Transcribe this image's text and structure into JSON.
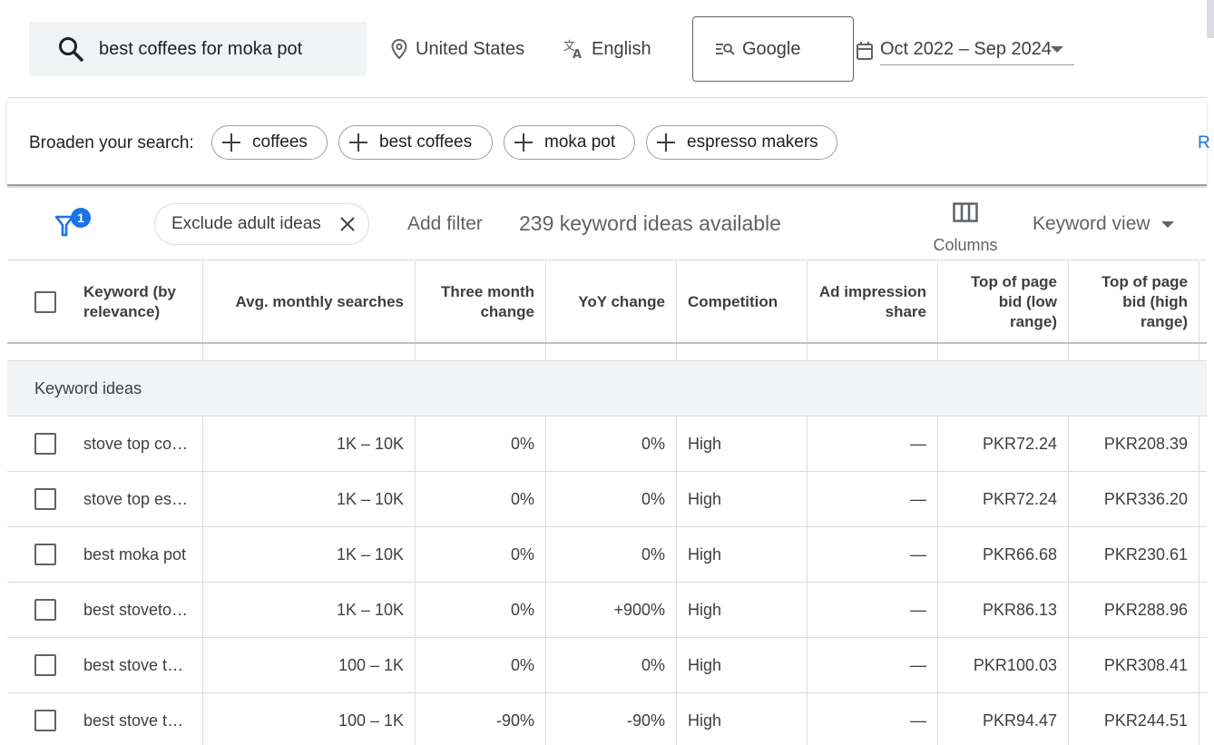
{
  "search": {
    "query": "best coffees for moka pot",
    "location": "United States",
    "language": "English",
    "network": "Google",
    "date_range": "Oct 2022 – Sep 2024"
  },
  "broaden": {
    "label": "Broaden your search:",
    "chips": [
      "coffees",
      "best coffees",
      "moka pot",
      "espresso makers"
    ],
    "more_link": "R"
  },
  "filters": {
    "badge_count": "1",
    "exclude_chip": "Exclude adult ideas",
    "add_filter": "Add filter",
    "ideas_count": "239 keyword ideas available",
    "columns_label": "Columns",
    "view_label": "Keyword view"
  },
  "table": {
    "headers": {
      "keyword": "Keyword (by relevance)",
      "searches": "Avg. monthly searches",
      "three_month": "Three month change",
      "yoy": "YoY change",
      "competition": "Competition",
      "impression": "Ad impression share",
      "bid_low": "Top of page bid (low range)",
      "bid_high": "Top of page bid (high range)"
    },
    "group_label": "Keyword ideas",
    "rows": [
      {
        "keyword": "stove top cof…",
        "searches": "1K – 10K",
        "three_month": "0%",
        "yoy": "0%",
        "competition": "High",
        "impression": "—",
        "bid_low": "PKR72.24",
        "bid_high": "PKR208.39"
      },
      {
        "keyword": "stove top es…",
        "searches": "1K – 10K",
        "three_month": "0%",
        "yoy": "0%",
        "competition": "High",
        "impression": "—",
        "bid_low": "PKR72.24",
        "bid_high": "PKR336.20"
      },
      {
        "keyword": "best moka pot",
        "searches": "1K – 10K",
        "three_month": "0%",
        "yoy": "0%",
        "competition": "High",
        "impression": "—",
        "bid_low": "PKR66.68",
        "bid_high": "PKR230.61"
      },
      {
        "keyword": "best stoveto…",
        "searches": "1K – 10K",
        "three_month": "0%",
        "yoy": "+900%",
        "competition": "High",
        "impression": "—",
        "bid_low": "PKR86.13",
        "bid_high": "PKR288.96"
      },
      {
        "keyword": "best stove to…",
        "searches": "100 – 1K",
        "three_month": "0%",
        "yoy": "0%",
        "competition": "High",
        "impression": "—",
        "bid_low": "PKR100.03",
        "bid_high": "PKR308.41"
      },
      {
        "keyword": "best stove to…",
        "searches": "100 – 1K",
        "three_month": "-90%",
        "yoy": "-90%",
        "competition": "High",
        "impression": "—",
        "bid_low": "PKR94.47",
        "bid_high": "PKR244.51"
      }
    ]
  },
  "colors": {
    "accent": "#1a73e8",
    "text": "#3c4043",
    "border": "#dadce0",
    "group_bg": "#f1f3f4"
  }
}
